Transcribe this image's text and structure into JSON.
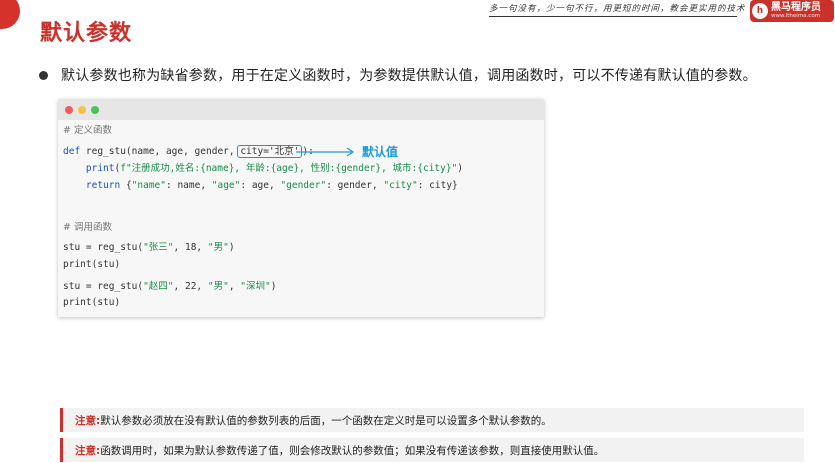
{
  "header": {
    "title": "默认参数",
    "slogan": "多一句没有，少一句不行，用更短的时间，教会更实用的技术",
    "logo": {
      "mark": "h",
      "name": "黑马程序员",
      "url": "www.itheima.com"
    }
  },
  "bullet": {
    "text": "默认参数也称为缺省参数，用于在定义函数时，为参数提供默认值，调用函数时，可以不传递有默认值的参数。"
  },
  "code": {
    "comment_define": "# 定义函数",
    "def_kw": "def",
    "def_sig_a": " reg_stu(name, age, gender, ",
    "def_city": "city='北京'",
    "def_sig_b": "):",
    "print_line": {
      "indent": "    ",
      "fn": "print",
      "open": "(",
      "fstr": "f\"注册成功,姓名:{name}, 年龄:{age}, 性别:{gender}, 城市:{city}\"",
      "close": ")"
    },
    "return_line": {
      "indent": "    ",
      "kw": "return",
      "k1": "\"name\"",
      "v1": ": name, ",
      "k2": "\"age\"",
      "v2": ": age, ",
      "k3": "\"gender\"",
      "v3": ": gender, ",
      "k4": "\"city\"",
      "v4": ": city}"
    },
    "comment_call": "# 调用函数",
    "call1": {
      "lhs": "stu = reg_stu(",
      "a1": "\"张三\"",
      "sep1": ", 18, ",
      "a2": "\"男\"",
      "rp": ")"
    },
    "print_stu_1": "print(stu)",
    "call2": {
      "lhs": "stu = reg_stu(",
      "a1": "\"赵四\"",
      "sep1": ", 22, ",
      "a2": "\"男\"",
      "sep2": ", ",
      "a3": "\"深圳\"",
      "rp": ")"
    },
    "print_stu_2": "print(stu)"
  },
  "annotation": {
    "label": "默认值"
  },
  "notes": [
    {
      "label": "注意:",
      "text": "默认参数必须放在没有默认值的参数列表的后面，一个函数在定义时是可以设置多个默认参数的。"
    },
    {
      "label": "注意:",
      "text": "函数调用时，如果为默认参数传递了值，则会修改默认的参数值；如果没有传递该参数，则直接使用默认值。"
    }
  ],
  "colors": {
    "brand_red": "#c8322a",
    "annotation_blue": "#1f9bd7",
    "keyword_blue": "#1a4fbd",
    "string_green": "#1a8a4a"
  }
}
